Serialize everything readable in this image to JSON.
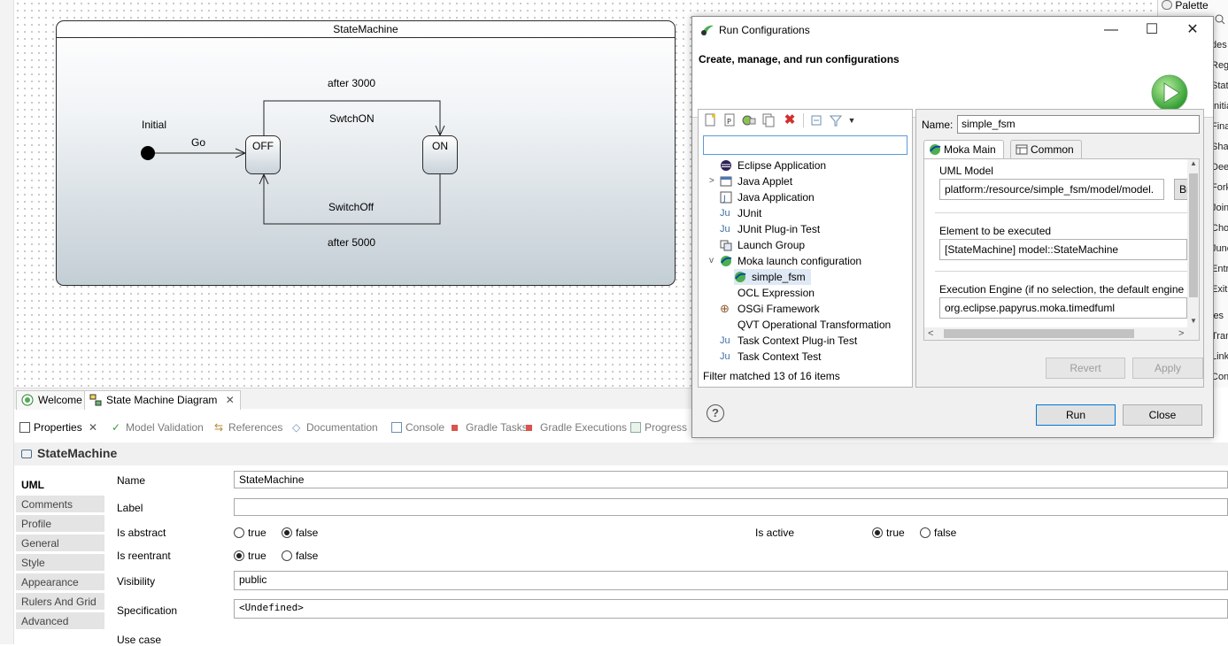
{
  "diagram": {
    "state_machine_title": "StateMachine",
    "initial_label": "Initial",
    "go_label": "Go",
    "after_3000": "after 3000",
    "switch_on": "SwtchON",
    "switch_off": "SwitchOff",
    "after_5000": "after 5000",
    "state_off": "OFF",
    "state_on": "ON"
  },
  "palette": {
    "title": "Palette",
    "items": [
      "des",
      "Regi",
      "State",
      "Initia",
      "Fina",
      "Shal",
      "Deep",
      "Fork",
      "Join",
      "Cho",
      "Junc",
      "Entr",
      "Exit",
      "ies",
      "Tran",
      "Link",
      "Con"
    ]
  },
  "editor_tabs": [
    {
      "label": "Welcome"
    },
    {
      "label": "State Machine Diagram",
      "close": "✕"
    }
  ],
  "view_tabs": [
    {
      "label": "Properties",
      "close": "✕"
    },
    {
      "label": "Model Validation"
    },
    {
      "label": "References"
    },
    {
      "label": "Documentation"
    },
    {
      "label": "Console"
    },
    {
      "label": "Gradle Tasks"
    },
    {
      "label": "Gradle Executions"
    },
    {
      "label": "Progress"
    }
  ],
  "properties": {
    "title": "StateMachine",
    "side_tabs": [
      "UML",
      "Comments",
      "Profile",
      "General",
      "Style",
      "Appearance",
      "Rulers And Grid",
      "Advanced"
    ],
    "name_label": "Name",
    "name_value": "StateMachine",
    "label_label": "Label",
    "label_value": "",
    "is_abstract_label": "Is abstract",
    "is_active_label": "Is active",
    "is_reentrant_label": "Is reentrant",
    "true_label": "true",
    "false_label": "false",
    "visibility_label": "Visibility",
    "visibility_value": "public",
    "specification_label": "Specification",
    "specification_value": "<Undefined>",
    "use_case_label": "Use case"
  },
  "dialog": {
    "title": "Run Configurations",
    "heading": "Create, manage, and run configurations",
    "win_minimize": "—",
    "win_maximize": "☐",
    "win_close": "✕",
    "filter_value": "",
    "tree": [
      {
        "label": "Eclipse Application"
      },
      {
        "label": "Java Applet"
      },
      {
        "label": "Java Application",
        "twisty": ">"
      },
      {
        "label": "JUnit"
      },
      {
        "label": "JUnit Plug-in Test"
      },
      {
        "label": "Launch Group"
      },
      {
        "label": "Moka launch configuration",
        "twisty": "v"
      },
      {
        "label": "simple_fsm"
      },
      {
        "label": "OCL Expression"
      },
      {
        "label": "OSGi Framework"
      },
      {
        "label": "QVT Operational Transformation"
      },
      {
        "label": "Task Context Plug-in Test"
      },
      {
        "label": "Task Context Test"
      }
    ],
    "filter_status": "Filter matched 13 of 16 items",
    "name_label": "Name:",
    "name_value": "simple_fsm",
    "tabs": [
      "Moka Main",
      "Common"
    ],
    "uml_model_label": "UML Model",
    "uml_model_value": "platform:/resource/simple_fsm/model/model.",
    "browse_label": "Br",
    "element_label": "Element to be executed",
    "element_value": "[StateMachine] model::StateMachine",
    "engine_label": "Execution Engine (if no selection, the default engine",
    "engine_value": "org.eclipse.papyrus.moka.timedfuml",
    "scroll_left": "<",
    "scroll_right": ">",
    "revert_label": "Revert",
    "apply_label": "Apply",
    "run_label": "Run",
    "close_label": "Close",
    "help_label": "?"
  },
  "colors": {
    "accent": "#0078d7",
    "moka_green": "#4caf50",
    "selection": "#dfe9f5"
  }
}
